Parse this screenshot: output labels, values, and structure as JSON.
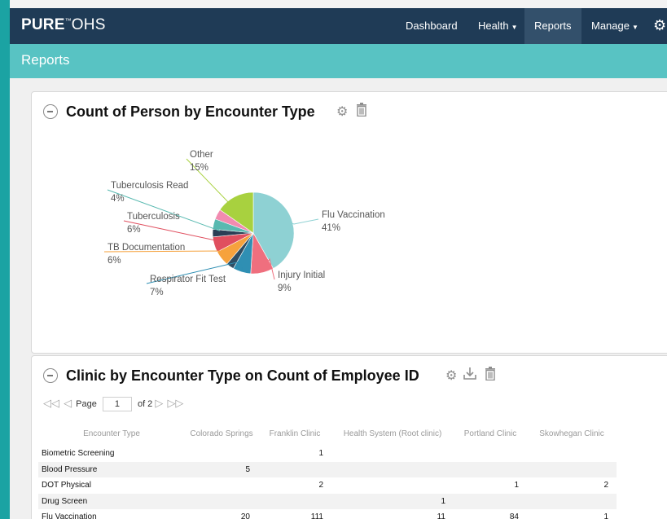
{
  "brand": {
    "bold": "PURE",
    "light": "OHS"
  },
  "nav": {
    "items": [
      {
        "label": "Dashboard",
        "caret": false
      },
      {
        "label": "Health",
        "caret": true
      },
      {
        "label": "Reports",
        "caret": false,
        "active": true
      },
      {
        "label": "Manage",
        "caret": true
      }
    ]
  },
  "page": {
    "title": "Reports"
  },
  "pie_panel": {
    "title": "Count of Person by Encounter Type",
    "chart_data": {
      "type": "pie",
      "slices": [
        {
          "label": "Flu Vaccination",
          "pct_label": "41%",
          "value": 41,
          "color": "#8ed1d3"
        },
        {
          "label": "Injury Initial",
          "pct_label": "9%",
          "value": 9,
          "color": "#ef6f7e"
        },
        {
          "label": "Respirator Fit Test",
          "pct_label": "7%",
          "value": 7,
          "color": "#2f8fb3"
        },
        {
          "label": "",
          "pct_label": "",
          "value": 3,
          "color": "#2e4d63"
        },
        {
          "label": "TB Documentation",
          "pct_label": "6%",
          "value": 6,
          "color": "#f6a23d"
        },
        {
          "label": "Tuberculosis",
          "pct_label": "6%",
          "value": 6,
          "color": "#e04f5f"
        },
        {
          "label": "",
          "pct_label": "",
          "value": 3,
          "color": "#2a3e55"
        },
        {
          "label": "Tuberculosis Read",
          "pct_label": "4%",
          "value": 4,
          "color": "#58b9b0"
        },
        {
          "label": "",
          "pct_label": "",
          "value": 4,
          "color": "#f18bb0"
        },
        {
          "label": "Other",
          "pct_label": "15%",
          "value": 15,
          "color": "#a8d13f"
        }
      ]
    }
  },
  "table_panel": {
    "title": "Clinic by Encounter Type on Count of Employee ID",
    "pager": {
      "page_label": "Page",
      "page_value": "1",
      "of_label": "of 2"
    },
    "columns": [
      "Encounter Type",
      "Colorado Springs",
      "Franklin Clinic",
      "Health System (Root clinic)",
      "Portland Clinic",
      "Skowhegan Clinic"
    ],
    "rows": [
      {
        "type": "Biometric Screening",
        "c1": "",
        "c2": "1",
        "c3": "",
        "c4": "",
        "c5": ""
      },
      {
        "type": "Blood Pressure",
        "c1": "5",
        "c2": "",
        "c3": "",
        "c4": "",
        "c5": ""
      },
      {
        "type": "DOT Physical",
        "c1": "",
        "c2": "2",
        "c3": "",
        "c4": "1",
        "c5": "2"
      },
      {
        "type": "Drug Screen",
        "c1": "",
        "c2": "",
        "c3": "1",
        "c4": "",
        "c5": ""
      },
      {
        "type": "Flu Vaccination",
        "c1": "20",
        "c2": "111",
        "c3": "11",
        "c4": "84",
        "c5": "1"
      }
    ]
  }
}
